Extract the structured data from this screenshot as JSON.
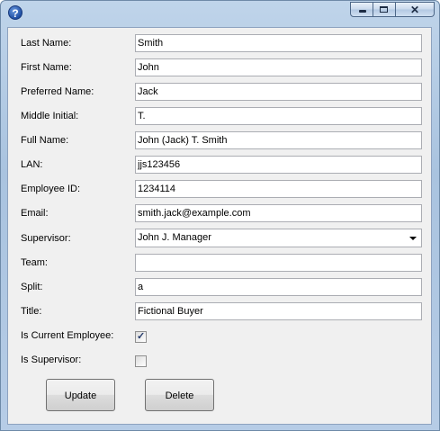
{
  "form": {
    "fields": [
      {
        "label": "Last Name:",
        "value": "Smith"
      },
      {
        "label": "First Name:",
        "value": "John"
      },
      {
        "label": "Preferred Name:",
        "value": "Jack"
      },
      {
        "label": "Middle Initial:",
        "value": "T."
      },
      {
        "label": "Full Name:",
        "value": "John (Jack) T. Smith"
      },
      {
        "label": "LAN:",
        "value": "jjs123456"
      },
      {
        "label": "Employee ID:",
        "value": "1234114"
      },
      {
        "label": "Email:",
        "value": "smith.jack@example.com"
      },
      {
        "label": "Supervisor:",
        "value": "John J. Manager"
      },
      {
        "label": "Team:",
        "value": ""
      },
      {
        "label": "Split:",
        "value": "a"
      },
      {
        "label": "Title:",
        "value": "Fictional Buyer"
      }
    ],
    "is_current_employee": {
      "label": "Is Current Employee:",
      "checked": true
    },
    "is_supervisor": {
      "label": "Is Supervisor:",
      "checked": false
    }
  },
  "buttons": {
    "update": "Update",
    "delete": "Delete"
  },
  "icons": {
    "help": "help-icon",
    "minimize": "minimize-icon",
    "maximize": "maximize-icon",
    "close": "close-icon"
  },
  "colors": {
    "client_bg": "#f0f0f0",
    "frame": "#a9c3df",
    "check": "#253b6b"
  }
}
